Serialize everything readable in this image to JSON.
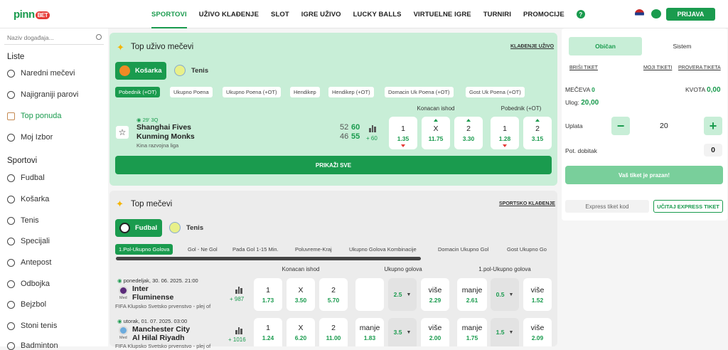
{
  "brand": {
    "logo": "pinn",
    "logo_badge": "BET"
  },
  "nav": [
    "SPORTOVI",
    "UŽIVO KLAĐENJE",
    "SLOT",
    "IGRE UŽIVO",
    "LUCKY BALLS",
    "VIRTUELNE IGRE",
    "TURNIRI",
    "PROMOCIJE"
  ],
  "header": {
    "help": "?",
    "login": "PRIJAVA"
  },
  "sidebar": {
    "search_placeholder": "Naziv događaja...",
    "lists_title": "Liste",
    "lists": [
      "Naredni mečevi",
      "Najigraniji parovi",
      "Top ponuda",
      "Moj Izbor"
    ],
    "sports_title": "Sportovi",
    "sports": [
      "Fudbal",
      "Košarka",
      "Tenis",
      "Specijali",
      "Antepost",
      "Odbojka",
      "Bejzbol",
      "Stoni tenis",
      "Badminton"
    ]
  },
  "live": {
    "title": "Top uživo mečevi",
    "link": "KLAĐENJE UŽIVO",
    "sports": [
      "Košarka",
      "Tenis"
    ],
    "markets": [
      "Pobednik (+OT)",
      "Ukupno Poena",
      "Ukupno Poena (+OT)",
      "Hendikep",
      "Hendikep (+OT)",
      "Domacin Uk Poena (+OT)",
      "Gost Uk Poena (+OT)"
    ],
    "headers": [
      "Konacan ishod",
      "Pobednik (+OT)"
    ],
    "match": {
      "time": "29' 3Q",
      "home": "Shanghai Fives",
      "away": "Kunming Monks",
      "league": "Kina razvojna liga",
      "home_p1": "52",
      "home_p2": "60",
      "away_p1": "46",
      "away_p2": "55",
      "more": "+ 60"
    },
    "odds": [
      {
        "l": "1",
        "v": "1.35"
      },
      {
        "l": "X",
        "v": "11.75"
      },
      {
        "l": "2",
        "v": "3.30"
      },
      {
        "l": "1",
        "v": "1.28"
      },
      {
        "l": "2",
        "v": "3.15"
      }
    ],
    "show_all": "PRIKAŽI SVE"
  },
  "top": {
    "title": "Top mečevi",
    "link": "SPORTSKO KLAĐENJE",
    "sports": [
      "Fudbal",
      "Tenis"
    ],
    "markets": [
      "1.Pol-Ukupno Golova",
      "Gol - Ne Gol",
      "Pada Gol 1-15 Min.",
      "Poluvreme-Kraj",
      "Ukupno Golova Kombinacije",
      "Domacin Ukupno Gol",
      "Gost Ukupno Go"
    ],
    "headers": [
      "Konacan ishod",
      "Ukupno golova",
      "1.pol-Ukupno golova"
    ],
    "matches": [
      {
        "date": "ponedeljak, 30. 06. 2025. 21:00",
        "home": "Inter",
        "away": "Fluminense",
        "badge": "Med",
        "league": "FIFA Klupsko Svetsko prvenstvo - plej of",
        "more": "+ 987",
        "odds": [
          {
            "l": "1",
            "v": "1.73"
          },
          {
            "l": "X",
            "v": "3.50"
          },
          {
            "l": "2",
            "v": "5.70"
          },
          {
            "l": "",
            "v": ""
          },
          {
            "l": "2.5",
            "v": ""
          },
          {
            "l": "više",
            "v": "2.29"
          },
          {
            "l": "manje",
            "v": "2.61"
          },
          {
            "l": "0.5",
            "v": ""
          },
          {
            "l": "više",
            "v": "1.52"
          }
        ]
      },
      {
        "date": "utorak, 01. 07. 2025. 03:00",
        "home": "Manchester City",
        "away": "Al Hilal Riyadh",
        "badge": "Med",
        "league": "FIFA Klupsko Svetsko prvenstvo - plej of",
        "more": "+ 1016",
        "odds": [
          {
            "l": "1",
            "v": "1.24"
          },
          {
            "l": "X",
            "v": "6.20"
          },
          {
            "l": "2",
            "v": "11.00"
          },
          {
            "l": "manje",
            "v": "1.83"
          },
          {
            "l": "3.5",
            "v": ""
          },
          {
            "l": "više",
            "v": "2.00"
          },
          {
            "l": "manje",
            "v": "1.75"
          },
          {
            "l": "1.5",
            "v": ""
          },
          {
            "l": "više",
            "v": "2.09"
          }
        ]
      }
    ]
  },
  "slip": {
    "tabs": [
      "Običan",
      "Sistem"
    ],
    "links": [
      "BRIŠI TIKET",
      "MOJI TIKETI",
      "PROVERA TIKETA"
    ],
    "matches_label": "MEČEVA",
    "matches_value": "0",
    "quota_label": "KVOTA",
    "quota_value": "0,00",
    "stake_label": "Ulog:",
    "stake_value": "20,00",
    "payment_label": "Uplata",
    "payment_value": "20",
    "minus": "−",
    "plus": "+",
    "win_label": "Pot. dobitak",
    "win_value": "0",
    "empty": "Vaš tiket je prazan!",
    "express_placeholder": "Express tiket kod",
    "express_button": "UČITAJ EXPRESS TIKET"
  },
  "colors": {
    "green": "#1a9b4e",
    "light_green": "#c8eed7",
    "red": "#e53935"
  }
}
